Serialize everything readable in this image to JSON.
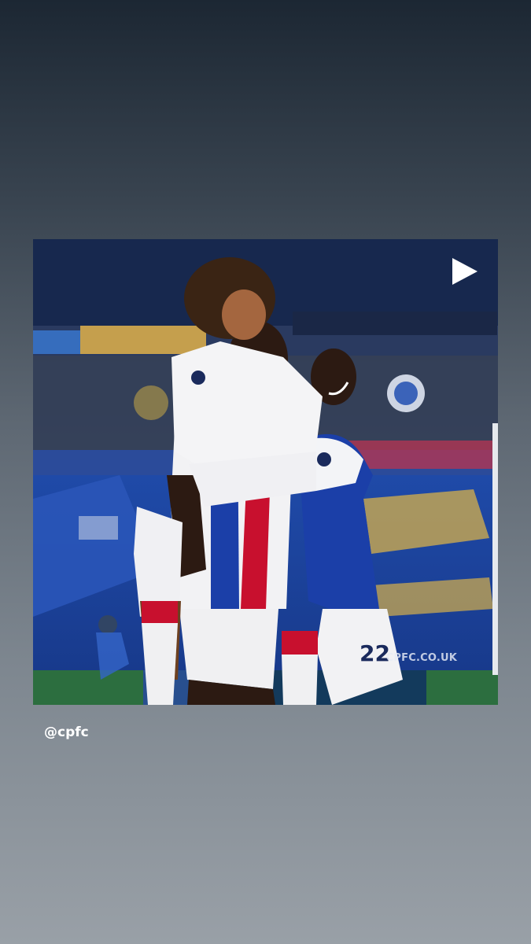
{
  "post": {
    "photo_alt": "Crystal Palace players celebrating a goal",
    "play_icon": "play-icon",
    "watermark": "CPFC.CO.UK",
    "shirt_number": "22"
  },
  "mention": {
    "handle": "@cpfc"
  },
  "colors": {
    "story_top": "#1c2733",
    "story_bottom": "#99a0a7",
    "kit_blue": "#1b3fa8",
    "kit_red": "#c8102e",
    "stand_yellow": "#e0b24a"
  }
}
